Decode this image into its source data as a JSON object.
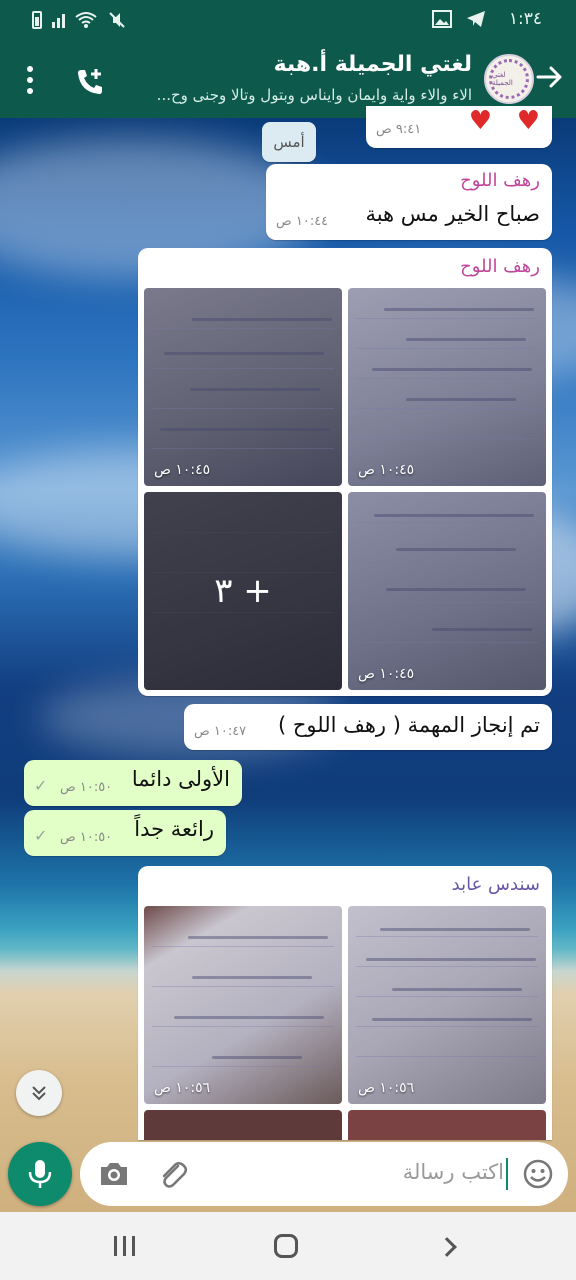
{
  "status_bar": {
    "time": "١:٣٤"
  },
  "header": {
    "title": "لغتي الجميلة أ.هبة",
    "subtitle": "الاء والاء واية وايمان وايناس وبتول وتالا وجنى وح...",
    "avatar_text": "لغتي الجميلة"
  },
  "messages": {
    "top_partial_time": "٩:٤١ ص",
    "day_chip": "أمس",
    "msg1": {
      "sender": "رهف اللوح",
      "text": "صباح الخير مس هبة",
      "time": "١٠:٤٤ ص"
    },
    "album1": {
      "sender": "رهف اللوح",
      "times": [
        "١٠:٤٥ ص",
        "١٠:٤٥ ص",
        "١٠:٤٥ ص"
      ],
      "more": "+ ٣"
    },
    "msg2": {
      "text": "تم إنجاز المهمة ( رهف اللوح )",
      "time": "١٠:٤٧ ص"
    },
    "msg3": {
      "text": "الأولى دائما",
      "time": "١٠:٥٠ ص"
    },
    "msg4": {
      "text": "رائعة جداً",
      "time": "١٠:٥٠ ص"
    },
    "album2": {
      "sender": "سندس عابد",
      "times": [
        "١٠:٥٦ ص",
        "١٠:٥٦ ص"
      ]
    }
  },
  "input": {
    "placeholder": "اكتب رسالة"
  },
  "colors": {
    "header": "#0d5a4c",
    "accent": "#0e8a6d",
    "outgoing": "#e2ffc7",
    "sender_pink": "#c0489a",
    "sender_purple": "#6a57a8"
  },
  "icons": [
    "back-arrow-icon",
    "add-call-icon",
    "menu-icon",
    "emoji-icon",
    "attach-icon",
    "camera-icon",
    "mic-icon",
    "chevron-down-icon"
  ]
}
